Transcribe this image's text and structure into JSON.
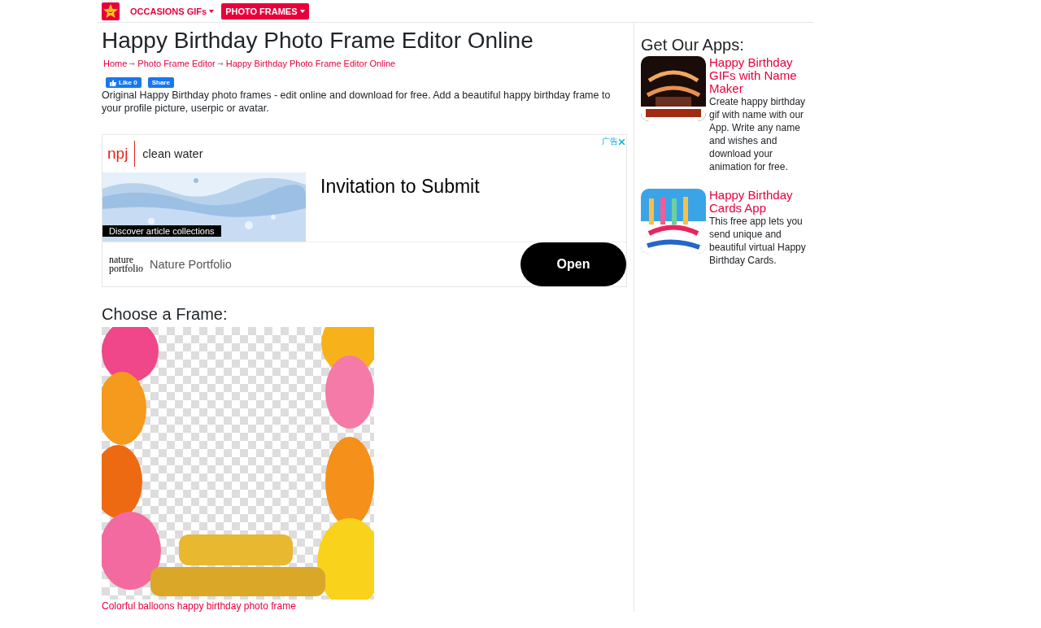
{
  "nav": {
    "items": [
      {
        "label": "OCCASIONS GIFs",
        "selected": false
      },
      {
        "label": "PHOTO FRAMES",
        "selected": true
      }
    ]
  },
  "title": "Happy Birthday Photo Frame Editor Online",
  "breadcrumb": [
    "Home",
    "Photo Frame Editor",
    "Happy Birthday Photo Frame Editor Online"
  ],
  "social": {
    "like": "Like 0",
    "share": "Share"
  },
  "description": "Original Happy Birthday photo frames - edit online and download for free. Add a beautiful happy birthday frame to your profile picture, userpic or avatar.",
  "ad": {
    "brand": "npj",
    "topic": "clean water",
    "caption": "Discover article collections",
    "headline": "Invitation to Submit",
    "marker": "广告",
    "publisher_logo": [
      "nature",
      "portfolio"
    ],
    "publisher": "Nature Portfolio",
    "button": "Open"
  },
  "frames": {
    "heading": "Choose a Frame:",
    "items": [
      {
        "kind": "picture",
        "caption": "Colorful balloons happy birthday photo frame"
      }
    ]
  },
  "sidebar": {
    "heading": "Get Our Apps:",
    "apps": [
      {
        "title": "Happy Birthday GIFs with Name Maker",
        "text": "Create happy birthday gif with name with our App. Write any name and wishes and download your animation for free."
      },
      {
        "title": "Happy Birthday Cards App",
        "text": "This free app lets you send unique and beautiful virtual Happy Birthday Cards."
      }
    ]
  }
}
